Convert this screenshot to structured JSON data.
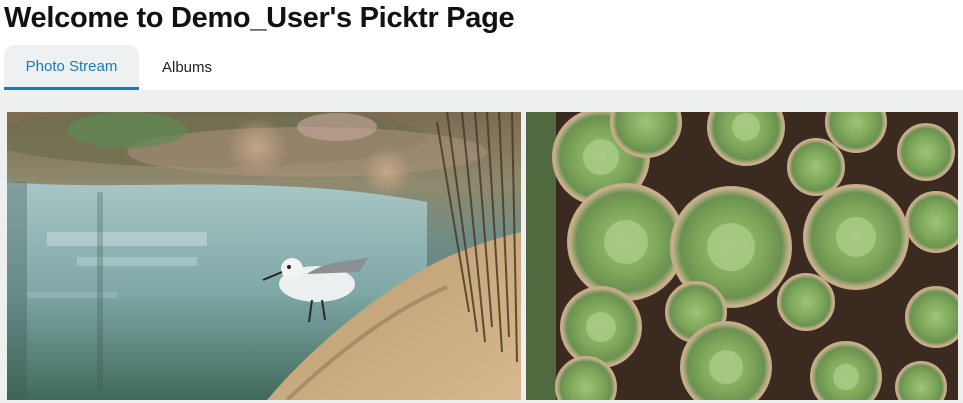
{
  "page": {
    "title": "Welcome to Demo_User's Picktr Page"
  },
  "tabs": [
    {
      "label": "Photo Stream",
      "active": true
    },
    {
      "label": "Albums",
      "active": false
    }
  ],
  "photos": [
    {
      "subject": "sandpiper-bird-by-water"
    },
    {
      "subject": "green-succulents"
    }
  ],
  "colors": {
    "accent": "#1a7ab8",
    "tab_active_bg": "#eef1f2",
    "stream_bg": "#eef0ef"
  }
}
